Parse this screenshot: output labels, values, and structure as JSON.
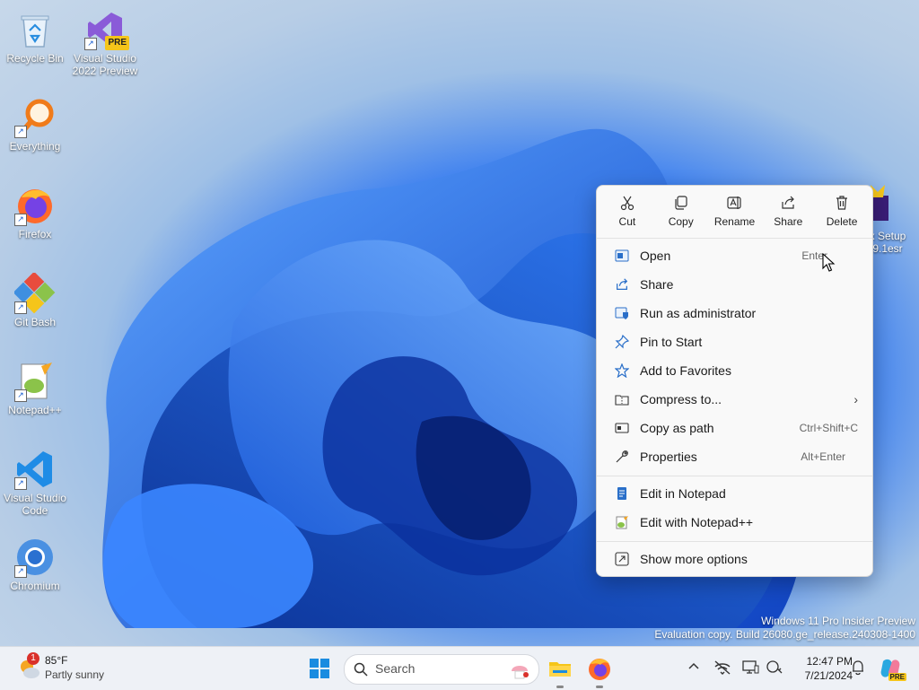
{
  "desktop": {
    "icons": [
      {
        "label": "Recycle Bin"
      },
      {
        "label": "Visual Studio 2022 Preview",
        "badge": "PRE"
      },
      {
        "label": "Everything"
      },
      {
        "label": "Firefox"
      },
      {
        "label": "Git Bash"
      },
      {
        "label": "Notepad++"
      },
      {
        "label": "Visual Studio Code"
      },
      {
        "label": "Chromium"
      }
    ],
    "partial_icon_label": "x Setup 9.1esr"
  },
  "context_menu": {
    "quick_actions": [
      {
        "label": "Cut",
        "icon": "scissors-icon"
      },
      {
        "label": "Copy",
        "icon": "copy-icon"
      },
      {
        "label": "Rename",
        "icon": "rename-icon"
      },
      {
        "label": "Share",
        "icon": "share-icon"
      },
      {
        "label": "Delete",
        "icon": "trash-icon"
      }
    ],
    "items": [
      {
        "label": "Open",
        "accel": "Enter",
        "icon": "window-icon"
      },
      {
        "label": "Share",
        "accel": "",
        "icon": "share-icon"
      },
      {
        "label": "Run as administrator",
        "accel": "",
        "icon": "shield-icon"
      },
      {
        "label": "Pin to Start",
        "accel": "",
        "icon": "pin-icon"
      },
      {
        "label": "Add to Favorites",
        "accel": "",
        "icon": "star-icon"
      },
      {
        "label": "Compress to...",
        "accel": "",
        "icon": "zip-icon"
      },
      {
        "label": "Copy as path",
        "accel": "Ctrl+Shift+C",
        "icon": "path-icon"
      },
      {
        "label": "Properties",
        "accel": "Alt+Enter",
        "icon": "wrench-icon"
      },
      {
        "label": "Edit in Notepad",
        "accel": "",
        "icon": "notepad-icon"
      },
      {
        "label": "Edit with Notepad++",
        "accel": "",
        "icon": "notepadpp-icon"
      },
      {
        "label": "Show more options",
        "accel": "",
        "icon": "more-options-icon"
      }
    ]
  },
  "watermark": {
    "line1": "Windows 11 Pro Insider Preview",
    "line2": "Evaluation copy. Build 26080.ge_release.240308-1400"
  },
  "taskbar": {
    "weather": {
      "temp": "85°F",
      "condition": "Partly sunny",
      "badge": "1"
    },
    "search_placeholder": "Search",
    "clock": {
      "time": "12:47 PM",
      "date": "7/21/2024"
    },
    "copilot_badge": "PRE"
  },
  "colors": {
    "accent": "#0067c0",
    "menu_bg": "#f9f9f9",
    "taskbar_bg": "#eef1f6"
  }
}
